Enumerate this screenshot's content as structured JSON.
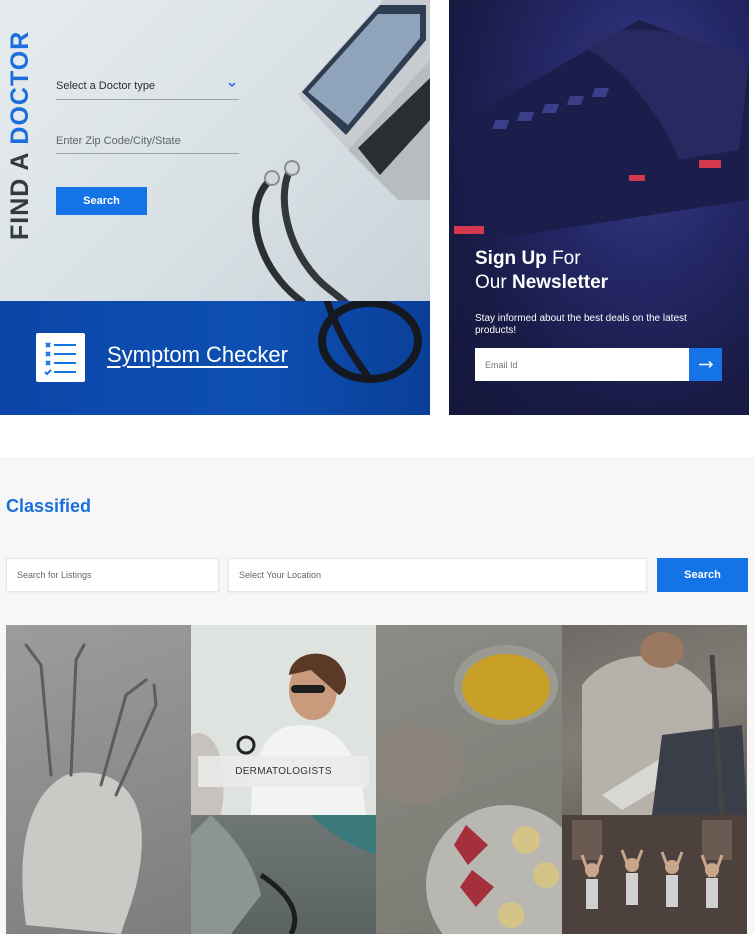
{
  "find_doctor": {
    "title_prefix": "FIND A",
    "title_accent": "DOCTOR",
    "doctor_type_select": "Select a Doctor type",
    "zip_placeholder": "Enter Zip Code/City/State",
    "search_label": "Search"
  },
  "symptom_checker": {
    "label": "Symptom Checker",
    "icon": "checklist-icon"
  },
  "newsletter": {
    "heading_line1_bold": "Sign Up",
    "heading_line1_rest": "For",
    "heading_line2_rest": "Our",
    "heading_line2_bold": "Newsletter",
    "description": "Stay informed about the best deals on the latest products!",
    "email_placeholder": "Email Id",
    "submit_icon": "arrow-right-icon"
  },
  "classified": {
    "title": "Classified",
    "listing_placeholder": "Search for Listings",
    "location_placeholder": "Select Your Location",
    "search_label": "Search",
    "tiles": [
      {
        "name": "dentist",
        "label": ""
      },
      {
        "name": "dermatologists",
        "label": "DERMATOLOGISTS"
      },
      {
        "name": "blood-pressure",
        "label": ""
      },
      {
        "name": "nutrition",
        "label": ""
      },
      {
        "name": "orthopedics",
        "label": ""
      },
      {
        "name": "fitness",
        "label": ""
      }
    ]
  },
  "colors": {
    "accent": "#1473e6",
    "title_blue": "#1a6fdc",
    "symptom_bg": "#0d4fb2",
    "newsletter_bg": "#252868"
  }
}
